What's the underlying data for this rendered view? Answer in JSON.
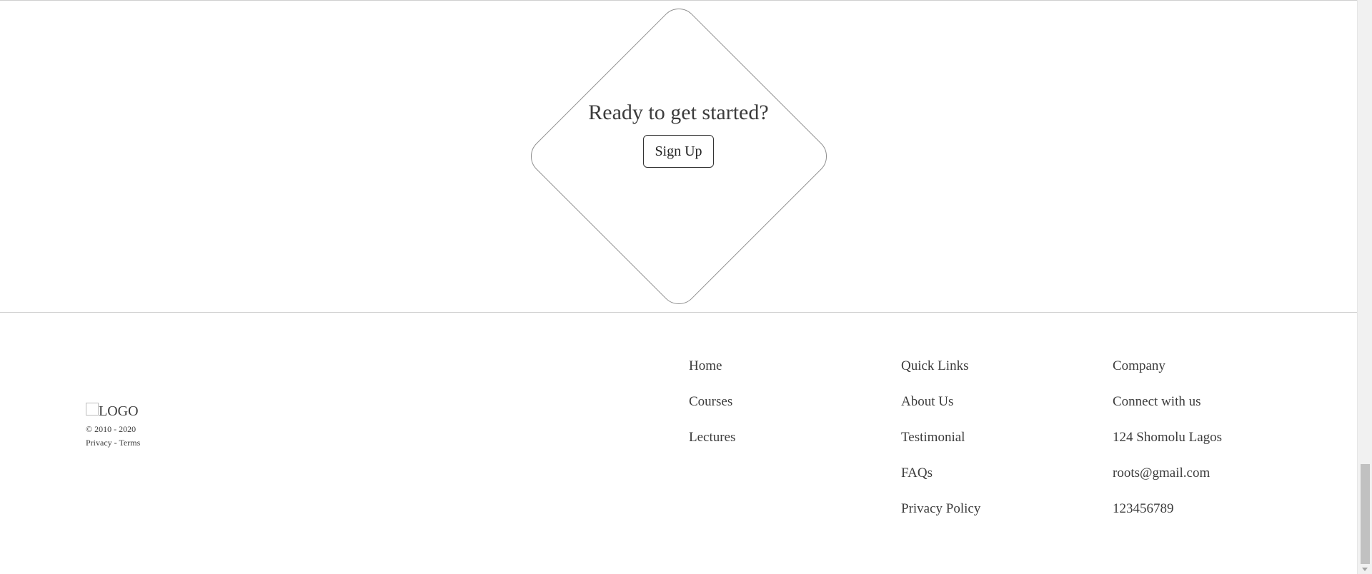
{
  "cta": {
    "title": "Ready to get started?",
    "button_label": "Sign Up"
  },
  "brand": {
    "logo_text": "LOGO",
    "copyright": "© 2010 - 2020",
    "privacy": "Privacy",
    "separator": " - ",
    "terms": "Terms"
  },
  "footer": {
    "col1": [
      "Home",
      "Courses",
      "Lectures"
    ],
    "col2": [
      "Quick Links",
      "About Us",
      "Testimonial",
      "FAQs",
      "Privacy Policy"
    ],
    "col3": [
      "Company",
      "Connect with us",
      "124 Shomolu Lagos",
      "roots@gmail.com",
      "123456789"
    ]
  },
  "colors": {
    "text": "#3c3c3c",
    "rule": "#cfcfcf",
    "diamond_border": "#8f8f8f"
  }
}
